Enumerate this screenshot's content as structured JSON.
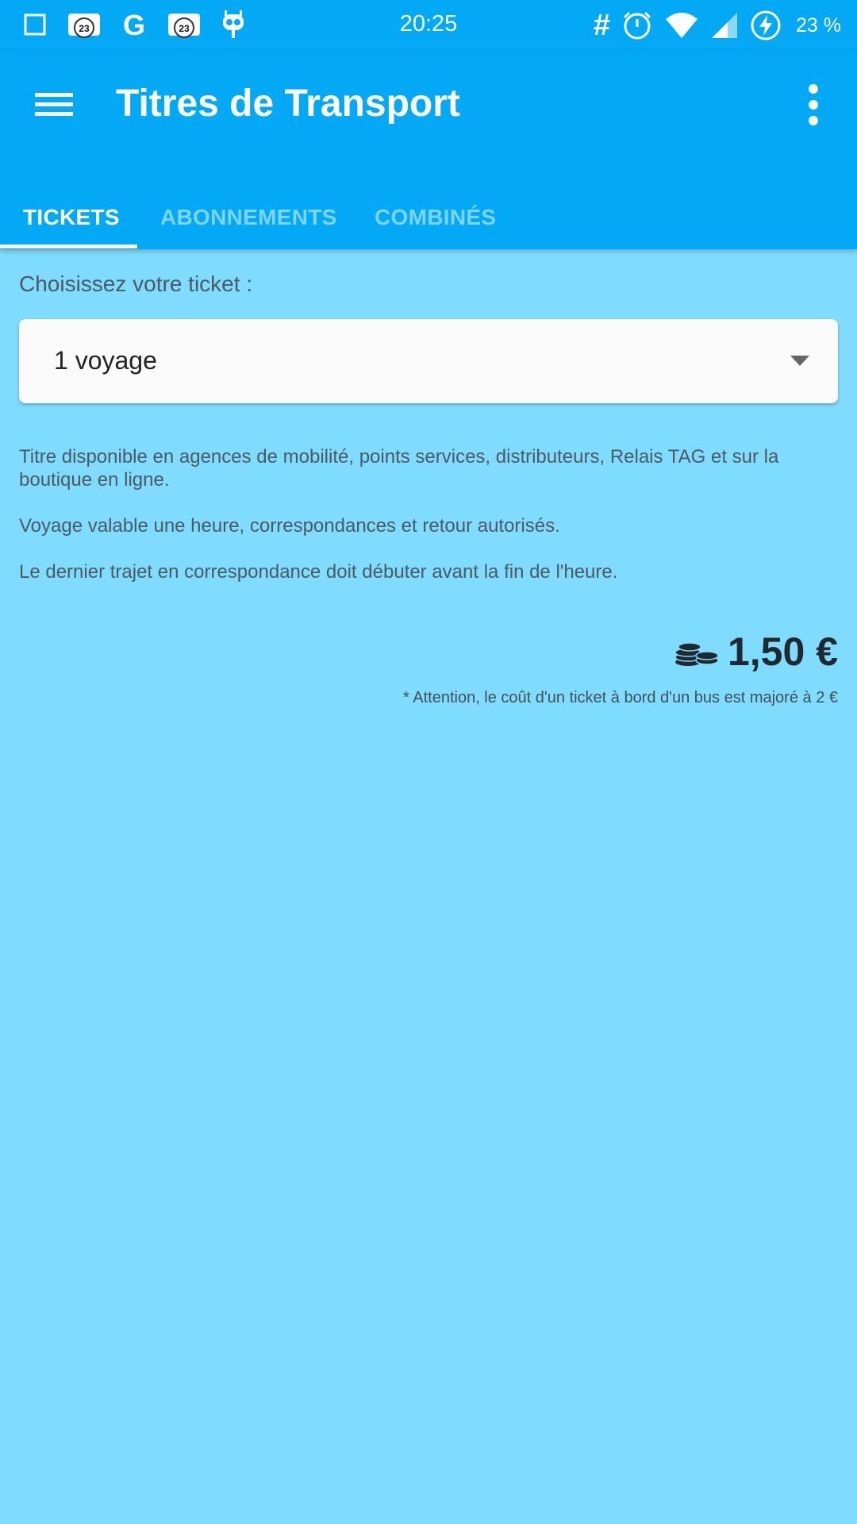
{
  "status_bar": {
    "time": "20:25",
    "battery_percent": "23 %",
    "left_icons": [
      "square-icon",
      "calendar-23-icon",
      "google-g-icon",
      "calendar-23-icon",
      "robot-icon"
    ],
    "calendar_day": "23",
    "google_letter": "G",
    "hash": "#",
    "right_icons": [
      "hash-icon",
      "alarm-icon",
      "wifi-icon",
      "signal-icon",
      "battery-charging-icon"
    ]
  },
  "app_bar": {
    "title": "Titres de Transport"
  },
  "tabs": [
    {
      "label": "TICKETS",
      "active": true
    },
    {
      "label": "ABONNEMENTS",
      "active": false
    },
    {
      "label": "COMBINÉS",
      "active": false
    }
  ],
  "ticket": {
    "choose_label": "Choisissez votre ticket :",
    "selected": "1 voyage",
    "description": [
      "Titre disponible en agences de mobilité, points services, distributeurs, Relais TAG et sur la boutique en ligne.",
      "Voyage valable une heure, correspondances et retour autorisés.",
      "Le dernier trajet en correspondance doit débuter avant la fin de l'heure."
    ],
    "price": "1,50 €",
    "note": "* Attention, le coût d'un ticket à bord d'un bus est majoré à 2 €"
  },
  "colors": {
    "primary": "#03a9f4",
    "background": "#80dcfe",
    "tab_inactive": "#7fd4fb"
  }
}
